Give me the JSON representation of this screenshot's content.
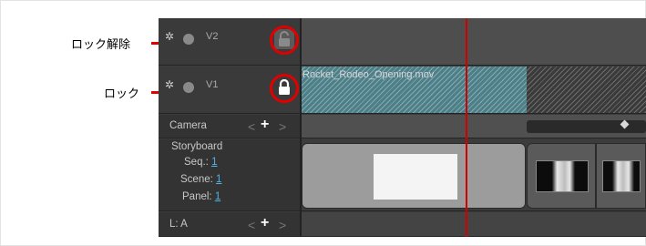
{
  "callouts": {
    "unlock": "ロック解除",
    "lock": "ロック"
  },
  "tracks": {
    "v2": {
      "name": "V2",
      "lock_state": "unlocked"
    },
    "v1": {
      "name": "V1",
      "lock_state": "locked",
      "clip_name": "Rocket_Rodeo_Opening.mov"
    }
  },
  "camera": {
    "label": "Camera",
    "prev": "<",
    "add": "+",
    "next": ">"
  },
  "storyboard": {
    "title": "Storyboard",
    "seq_label": "Seq.:",
    "seq_value": "1",
    "scene_label": "Scene:",
    "scene_value": "1",
    "panel_label": "Panel:",
    "panel_value": "1"
  },
  "audio": {
    "label": "L: A",
    "prev": "<",
    "add": "+",
    "next": ">"
  },
  "colors": {
    "callout_red": "#e10000",
    "link_blue": "#4fb3e6",
    "clip_teal": "#4d7f88"
  },
  "icons": {
    "track_enable": "snowflake-icon",
    "track_visibility": "dot-icon",
    "lock_open": "unlocked-lock-icon",
    "lock_closed": "locked-lock-icon"
  }
}
